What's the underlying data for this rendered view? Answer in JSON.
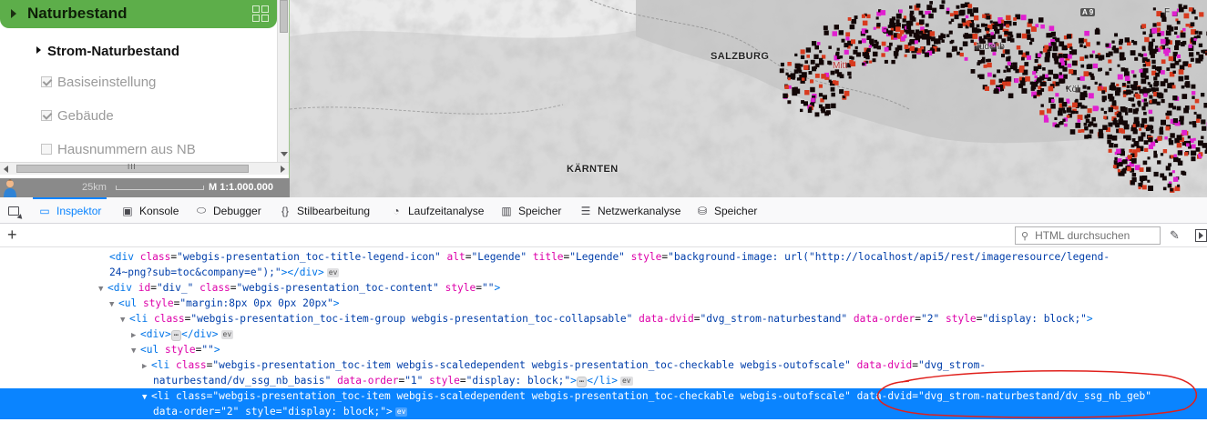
{
  "toc": {
    "group_title": "Naturbestand",
    "subgroup": "Strom-Naturbestand",
    "items": [
      {
        "label": "Basiseinstellung",
        "checked": true
      },
      {
        "label": "Gebäude",
        "checked": true
      },
      {
        "label": "Hausnummern aus NB",
        "checked": false
      }
    ],
    "hscroll_grip": "III"
  },
  "map": {
    "labels": {
      "salzburg": "SALZBURG",
      "kaernten": "KÄRNTEN"
    },
    "small_labels": {
      "judenburg": "Judenb",
      "koeln": "Köl",
      "top_right": "F",
      "left_town": "Mitt"
    },
    "road_badge": "A 9",
    "scale_distance": "25km",
    "scale_ratio": "M 1:1.000.000"
  },
  "devtools": {
    "tabs": [
      {
        "label": "Inspektor",
        "icon": "inspector-icon",
        "active": true
      },
      {
        "label": "Konsole",
        "icon": "console-icon",
        "active": false
      },
      {
        "label": "Debugger",
        "icon": "debugger-icon",
        "active": false
      },
      {
        "label": "Stilbearbeitung",
        "icon": "style-editor-icon",
        "active": false
      },
      {
        "label": "Laufzeitanalyse",
        "icon": "performance-icon",
        "active": false
      },
      {
        "label": "Speicher",
        "icon": "memory-icon",
        "active": false
      },
      {
        "label": "Netzwerkanalyse",
        "icon": "network-icon",
        "active": false
      },
      {
        "label": "Speicher",
        "icon": "storage-icon",
        "active": false
      }
    ],
    "search_placeholder": "HTML durchsuchen",
    "add_node": "+",
    "markup_lines": [
      {
        "indent": 0,
        "text": "<div class=\"webgis-presentation_toc-title-legend-icon\" alt=\"Legende\" title=\"Legende\" style=\"background-image: url(\"http://localhost/api5/rest/imageresource/legend-"
      },
      {
        "indent": 0,
        "text": "24~png?sub=toc&company=e\");\"></div>"
      },
      {
        "indent": 0,
        "text": "<div id=\"div_\" class=\"webgis-presentation_toc-content\" style=\"\">"
      },
      {
        "indent": 1,
        "text": "<ul style=\"margin:8px 0px 0px 20px\">"
      },
      {
        "indent": 2,
        "text": "<li class=\"webgis-presentation_toc-item-group webgis-presentation_toc-collapsable\" data-dvid=\"dvg_strom-naturbestand\" data-order=\"2\" style=\"display: block;\">"
      },
      {
        "indent": 3,
        "text": "<div>…</div>"
      },
      {
        "indent": 3,
        "text": "<ul style=\"\">"
      },
      {
        "indent": 4,
        "text": "<li class=\"webgis-presentation_toc-item webgis-scaledependent webgis-presentation_toc-checkable webgis-outofscale\" data-dvid=\"dvg_strom-"
      },
      {
        "indent": 4,
        "text": "naturbestand/dv_ssg_nb_basis\" data-order=\"1\" style=\"display: block;\">…</li>"
      },
      {
        "indent": 4,
        "text": "<li class=\"webgis-presentation_toc-item webgis-scaledependent webgis-presentation_toc-checkable webgis-outofscale\" data-dvid=\"dvg_strom-naturbestand/dv_ssg_nb_geb\""
      },
      {
        "indent": 4,
        "text": "data-order=\"2\" style=\"display: block;\">"
      }
    ]
  },
  "colors": {
    "toc_header": "#5dae4a",
    "selection": "#0a84ff",
    "annotation": "#e0201c",
    "tag": "#0074e8",
    "attr_name": "#dd00a9",
    "attr_value": "#003eaa"
  }
}
